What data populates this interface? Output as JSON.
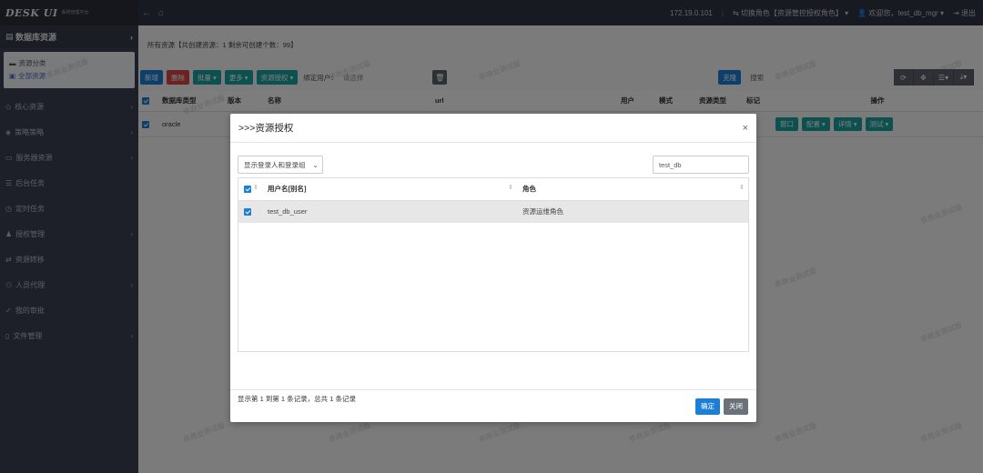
{
  "topbar": {
    "logo_text": "DESK UI",
    "logo_sub": "系统管理平台",
    "ip": "172.19.0.101",
    "switch_role": "切换角色【资源管控授权角色】",
    "welcome": "欢迎您，test_db_mgr",
    "logout": "退出"
  },
  "sidebar": {
    "header": "数据库资源",
    "sub_items": [
      {
        "label": "资源分类"
      },
      {
        "label": "全部资源"
      }
    ],
    "items": [
      {
        "label": "核心资源",
        "chevron": true
      },
      {
        "label": "策略策略",
        "chevron": true
      },
      {
        "label": "服务器资源",
        "chevron": true
      },
      {
        "label": "后台任务",
        "chevron": false
      },
      {
        "label": "定时任务",
        "chevron": false
      },
      {
        "label": "授权管理",
        "chevron": true
      },
      {
        "label": "资源转移",
        "chevron": false
      },
      {
        "label": "人员代理",
        "chevron": true
      },
      {
        "label": "我的审批",
        "chevron": false
      },
      {
        "label": "文件管理",
        "chevron": true
      }
    ]
  },
  "stats": {
    "text": "所有资源【共创建资源：1   剩余可创建个数：99】"
  },
  "toolbar": {
    "new": "新增",
    "delete": "删除",
    "batch": "批量",
    "more": "更多",
    "grant": "资源授权",
    "bind_label": "绑定用户：",
    "bind_placeholder": "请选择",
    "clone": "克隆",
    "search": "搜索"
  },
  "main_table": {
    "headers": [
      "数据库类型",
      "版本",
      "名称",
      "url",
      "用户",
      "模式",
      "资源类型",
      "标记",
      "操作"
    ],
    "rows": [
      {
        "db_type": "oracle",
        "version": "",
        "name": "",
        "url": "",
        "user": "",
        "mode": "",
        "res_type": "",
        "mark": ""
      }
    ],
    "row_actions": [
      "窗口",
      "配置",
      "详情",
      "测试"
    ]
  },
  "watermark": "非商业测试版",
  "modal": {
    "title": ">>>资源授权",
    "close": "×",
    "filter_select": "显示登录人和登录组",
    "search_value": "test_db",
    "headers": [
      "用户名[别名]",
      "角色"
    ],
    "rows": [
      {
        "username": "test_db_user",
        "role": "资源运维角色"
      }
    ],
    "info": "显示第 1 到第 1 条记录，总共 1 条记录",
    "confirm": "确定",
    "cancel": "关闭"
  }
}
